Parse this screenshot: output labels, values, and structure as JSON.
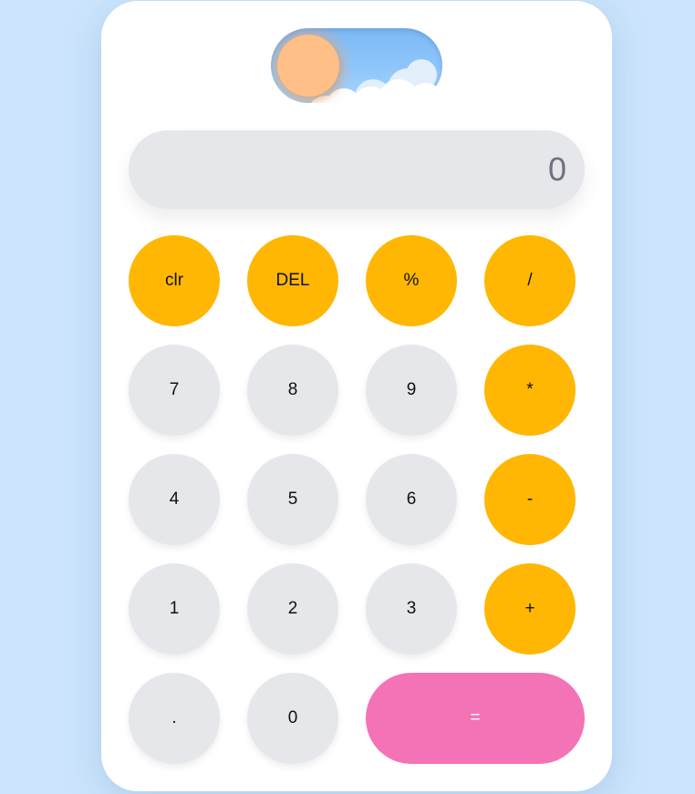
{
  "colors": {
    "page_background": "#cce5fc",
    "card_background": "#ffffff",
    "display_background": "#e5e7eb",
    "display_text": "#6b7280",
    "number_key": "#e5e7eb",
    "operator_key": "#ffb703",
    "equals_key": "#f472b6",
    "toggle_sky": "#7db9f5",
    "toggle_sun": "#ffbf86"
  },
  "theme_toggle": {
    "icon": "sun-icon",
    "scene": "sky-with-clouds"
  },
  "display": {
    "value": "0"
  },
  "keypad": {
    "clear": "clr",
    "delete": "DEL",
    "percent": "%",
    "divide": "/",
    "seven": "7",
    "eight": "8",
    "nine": "9",
    "multiply": "*",
    "four": "4",
    "five": "5",
    "six": "6",
    "subtract": "-",
    "one": "1",
    "two": "2",
    "three": "3",
    "add": "+",
    "decimal": ".",
    "zero": "0",
    "equals": "="
  }
}
